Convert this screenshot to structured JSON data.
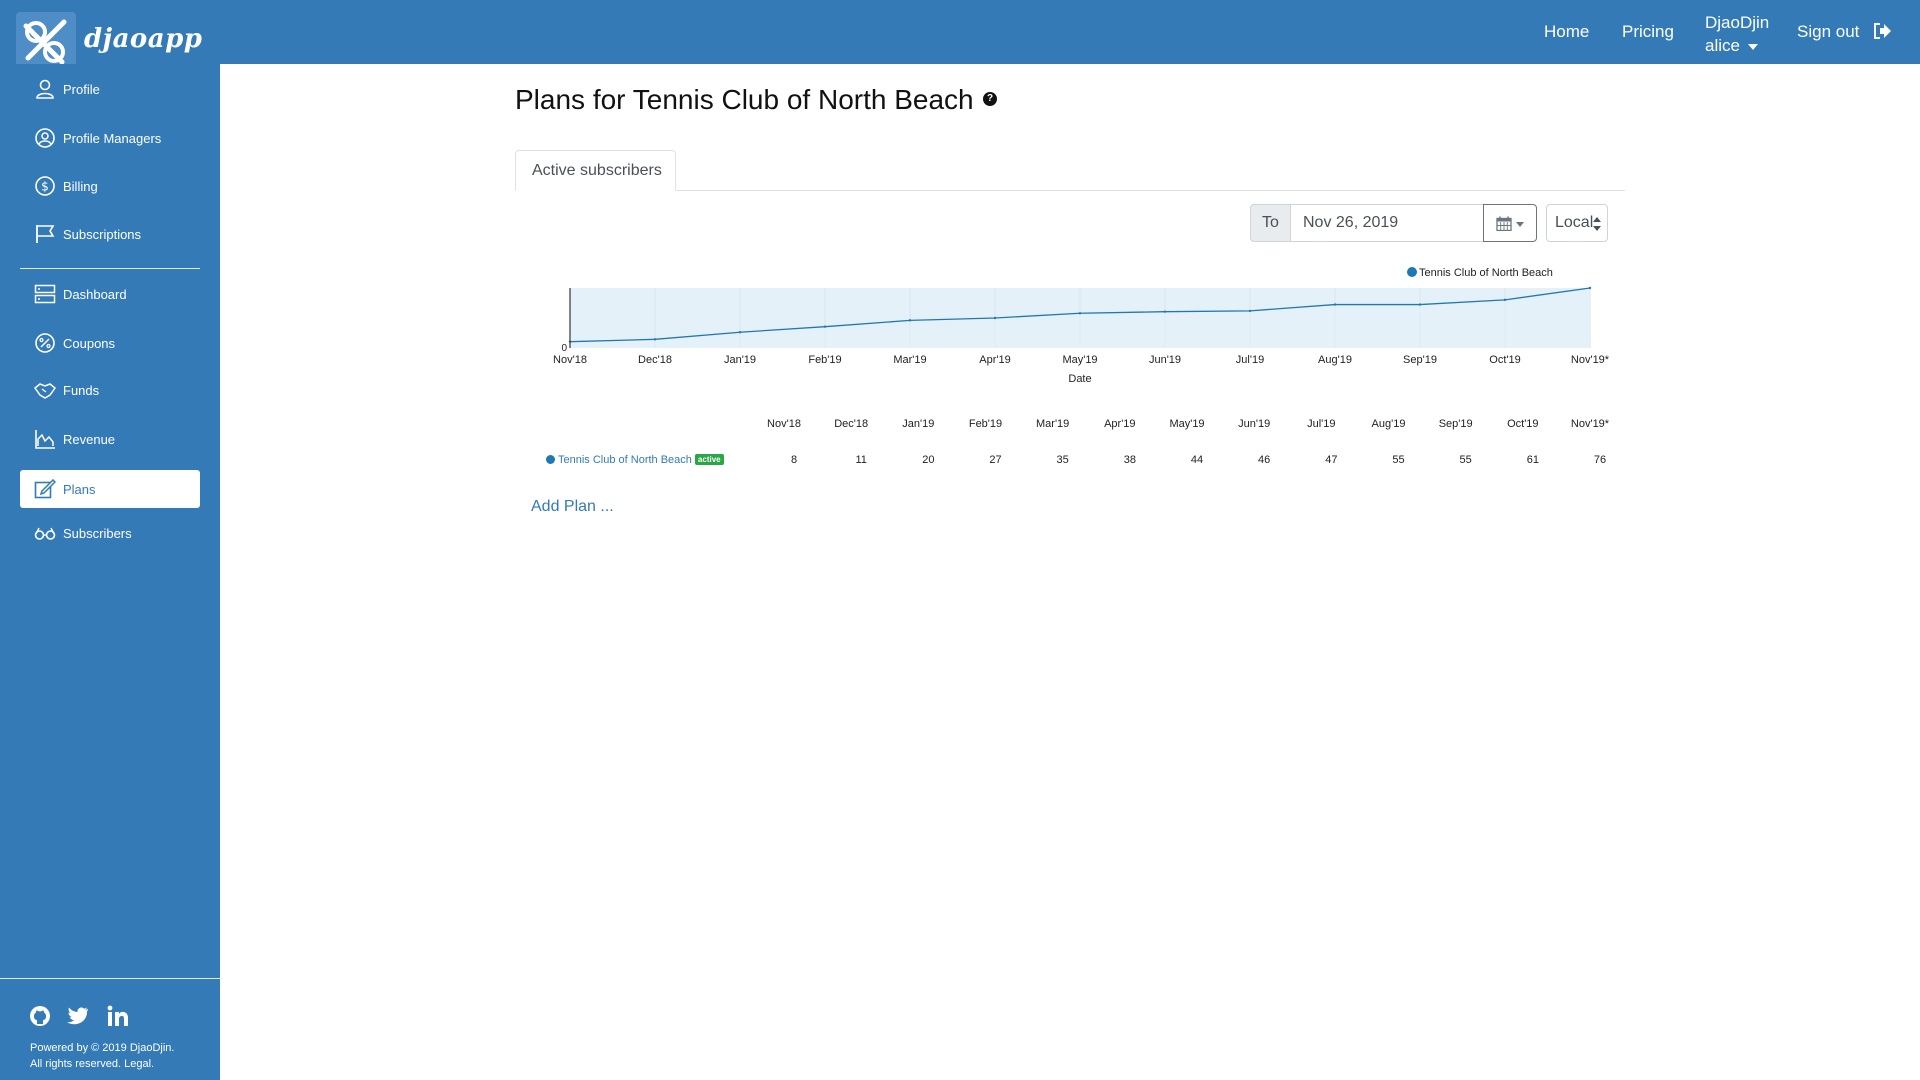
{
  "header": {
    "brand": "djaoapp",
    "nav": {
      "home": "Home",
      "pricing": "Pricing",
      "user_org": "DjaoDjin",
      "user_name": "alice",
      "signout": "Sign out"
    }
  },
  "sidebar": {
    "items": [
      {
        "label": "Profile",
        "icon": "user-icon"
      },
      {
        "label": "Profile Managers",
        "icon": "user-circle-icon"
      },
      {
        "label": "Billing",
        "icon": "dollar-icon"
      },
      {
        "label": "Subscriptions",
        "icon": "flag-icon"
      },
      {
        "label": "Dashboard",
        "icon": "server-icon"
      },
      {
        "label": "Coupons",
        "icon": "percent-icon"
      },
      {
        "label": "Funds",
        "icon": "handshake-icon"
      },
      {
        "label": "Revenue",
        "icon": "chart-icon"
      },
      {
        "label": "Plans",
        "icon": "edit-icon",
        "active": true
      },
      {
        "label": "Subscribers",
        "icon": "glasses-icon"
      }
    ],
    "footer": {
      "social": [
        "github-icon",
        "twitter-icon",
        "linkedin-icon"
      ],
      "powered_by": "Powered by © 2019 DjaoDjin.",
      "rights": "All rights reserved. Legal."
    }
  },
  "main": {
    "title": "Plans for Tennis Club of North Beach",
    "help": "?",
    "tab_active": "Active subscribers",
    "date_filter": {
      "to_label": "To",
      "date_value": "Nov 26, 2019",
      "timezone": "Local"
    },
    "add_plan": "Add Plan ..."
  },
  "chart_data": {
    "type": "area",
    "x": [
      "Nov'18",
      "Dec'18",
      "Jan'19",
      "Feb'19",
      "Mar'19",
      "Apr'19",
      "May'19",
      "Jun'19",
      "Jul'19",
      "Aug'19",
      "Sep'19",
      "Oct'19",
      "Nov'19*"
    ],
    "xlabel": "Date",
    "ylabel": "",
    "y_tick_labels": [
      "0"
    ],
    "ylim": [
      0,
      76
    ],
    "legend_position": "top-right",
    "grid": true,
    "series": [
      {
        "name": "Tennis Club of North Beach",
        "values": [
          8,
          11,
          20,
          27,
          35,
          38,
          44,
          46,
          47,
          55,
          55,
          61,
          76
        ],
        "color": "#1f77b4",
        "fill": "#e5f1f9"
      }
    ]
  },
  "table": {
    "headers": [
      "Nov'18",
      "Dec'18",
      "Jan'19",
      "Feb'19",
      "Mar'19",
      "Apr'19",
      "May'19",
      "Jun'19",
      "Jul'19",
      "Aug'19",
      "Sep'19",
      "Oct'19",
      "Nov'19*"
    ],
    "rows": [
      {
        "plan": "Tennis Club of North Beach",
        "badge": "active",
        "values": [
          "8",
          "11",
          "20",
          "27",
          "35",
          "38",
          "44",
          "46",
          "47",
          "55",
          "55",
          "61",
          "76"
        ]
      }
    ]
  }
}
